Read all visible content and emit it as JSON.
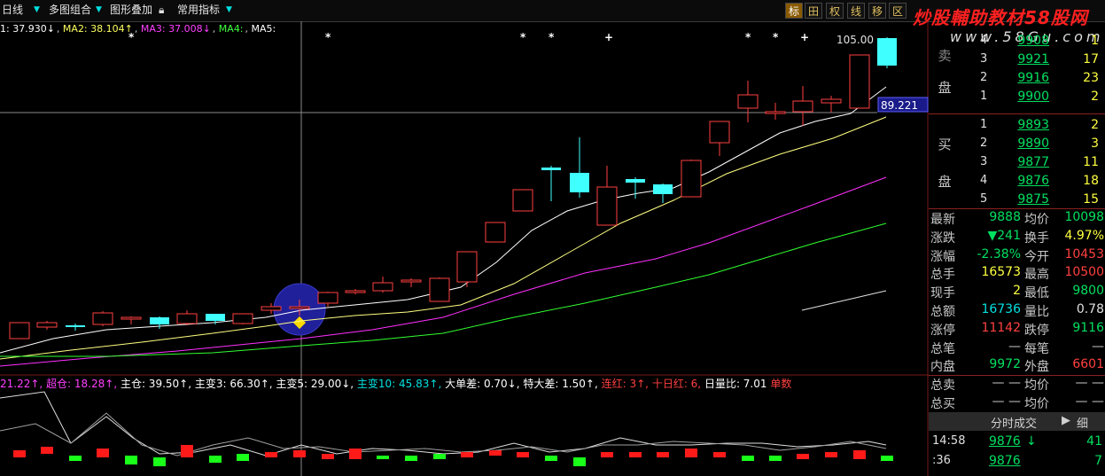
{
  "toolbar": {
    "items": [
      "日线",
      "多图组合",
      "图形叠加",
      "常用指标"
    ],
    "right_buttons": [
      "标",
      "田",
      "权",
      "线",
      "移",
      "区"
    ],
    "active_button": "标"
  },
  "watermark": {
    "line1": "炒股輔助教材58股网",
    "line2": "www.58Gu.com"
  },
  "ma_bar": [
    {
      "text": "1: 37.930↓",
      "color": "#ffffff"
    },
    {
      "text": "MA2: 38.104↑",
      "color": "#ffff60"
    },
    {
      "text": "MA3: 37.008↓",
      "color": "#ff40ff"
    },
    {
      "text": "MA4:",
      "color": "#40ff40"
    },
    {
      "text": "MA5:",
      "color": "#ffffff"
    }
  ],
  "price_labels": {
    "high": "105.00",
    "crosshair": "89.221"
  },
  "indicator_bar": [
    {
      "text": "21.22↑,",
      "color": "#ff40ff"
    },
    {
      "text": "超仓: 18.28↑,",
      "color": "#ff40ff"
    },
    {
      "text": "主仓: 39.50↑,",
      "color": "#ffffff"
    },
    {
      "text": "主变3: 66.30↑,",
      "color": "#ffffff"
    },
    {
      "text": "主变5: 29.00↓,",
      "color": "#ffffff"
    },
    {
      "text": "主变10: 45.83↑,",
      "color": "#00e0e0"
    },
    {
      "text": "大单差: 0.70↓,",
      "color": "#ffffff"
    },
    {
      "text": "特大差: 1.50↑,",
      "color": "#ffffff"
    },
    {
      "text": "连红: 3↑,",
      "color": "#ff4040"
    },
    {
      "text": "十日红: 6,",
      "color": "#ff4040"
    },
    {
      "text": "日量比: 7.01",
      "color": "#ffffff"
    },
    {
      "text": "单数",
      "color": "#ff4040"
    }
  ],
  "order_book": {
    "sell_label": "卖盘",
    "buy_label": "买盘",
    "sell": [
      {
        "lvl": "4",
        "price": "9908",
        "qty": "1"
      },
      {
        "lvl": "3",
        "price": "9921",
        "qty": "17"
      },
      {
        "lvl": "2",
        "price": "9916",
        "qty": "23"
      },
      {
        "lvl": "1",
        "price": "9900",
        "qty": "2"
      }
    ],
    "buy": [
      {
        "lvl": "1",
        "price": "9893",
        "qty": "2"
      },
      {
        "lvl": "2",
        "price": "9890",
        "qty": "3"
      },
      {
        "lvl": "3",
        "price": "9877",
        "qty": "11"
      },
      {
        "lvl": "4",
        "price": "9876",
        "qty": "18"
      },
      {
        "lvl": "5",
        "price": "9875",
        "qty": "15"
      }
    ]
  },
  "stats": [
    {
      "l": "最新",
      "v1": "9888",
      "c1": "#00e060",
      "l2": "均价",
      "v2": "10098",
      "c2": "#00e060"
    },
    {
      "l": "涨跌",
      "v1": "▼241",
      "c1": "#00e060",
      "l2": "换手",
      "v2": "4.97%",
      "c2": "#ffff40"
    },
    {
      "l": "涨幅",
      "v1": "-2.38%",
      "c1": "#00e060",
      "l2": "今开",
      "v2": "10453",
      "c2": "#ff4040"
    },
    {
      "l": "总手",
      "v1": "16573",
      "c1": "#ffff40",
      "l2": "最高",
      "v2": "10500",
      "c2": "#ff4040"
    },
    {
      "l": "现手",
      "v1": "2",
      "c1": "#ffff40",
      "l2": "最低",
      "v2": "9800",
      "c2": "#00e060"
    },
    {
      "l": "总额",
      "v1": "16736",
      "c1": "#00e0e0",
      "l2": "量比",
      "v2": "0.78",
      "c2": "#e0e0e0"
    },
    {
      "l": "涨停",
      "v1": "11142",
      "c1": "#ff4040",
      "l2": "跌停",
      "v2": "9116",
      "c2": "#00e060"
    },
    {
      "l": "总笔",
      "v1": "—",
      "c1": "#c8c8c8",
      "l2": "每笔",
      "v2": "—",
      "c2": "#c8c8c8"
    },
    {
      "l": "内盘",
      "v1": "9972",
      "c1": "#00e060",
      "l2": "外盘",
      "v2": "6601",
      "c2": "#ff4040"
    },
    {
      "l": "总卖",
      "v1": "— —",
      "c1": "#c8c8c8",
      "l2": "均价",
      "v2": "— —",
      "c2": "#c8c8c8"
    },
    {
      "l": "总买",
      "v1": "— —",
      "c1": "#c8c8c8",
      "l2": "均价",
      "v2": "— —",
      "c2": "#c8c8c8"
    }
  ],
  "ticks": {
    "header": "分时成交",
    "detail_button": "细",
    "rows": [
      {
        "time": "14:58",
        "price": "9876",
        "arrow": "↓",
        "vol": "41"
      },
      {
        "time": ":36",
        "price": "9876",
        "arrow": "",
        "vol": "7"
      }
    ]
  },
  "colors": {
    "up": "#ff4040",
    "down": "#40ffff",
    "ma1": "#ffffff",
    "ma2": "#ffff80",
    "ma3": "#ff30ff",
    "ma4": "#30ff30",
    "crosshair": "#888888",
    "marker_circle": "#2020a0"
  }
}
